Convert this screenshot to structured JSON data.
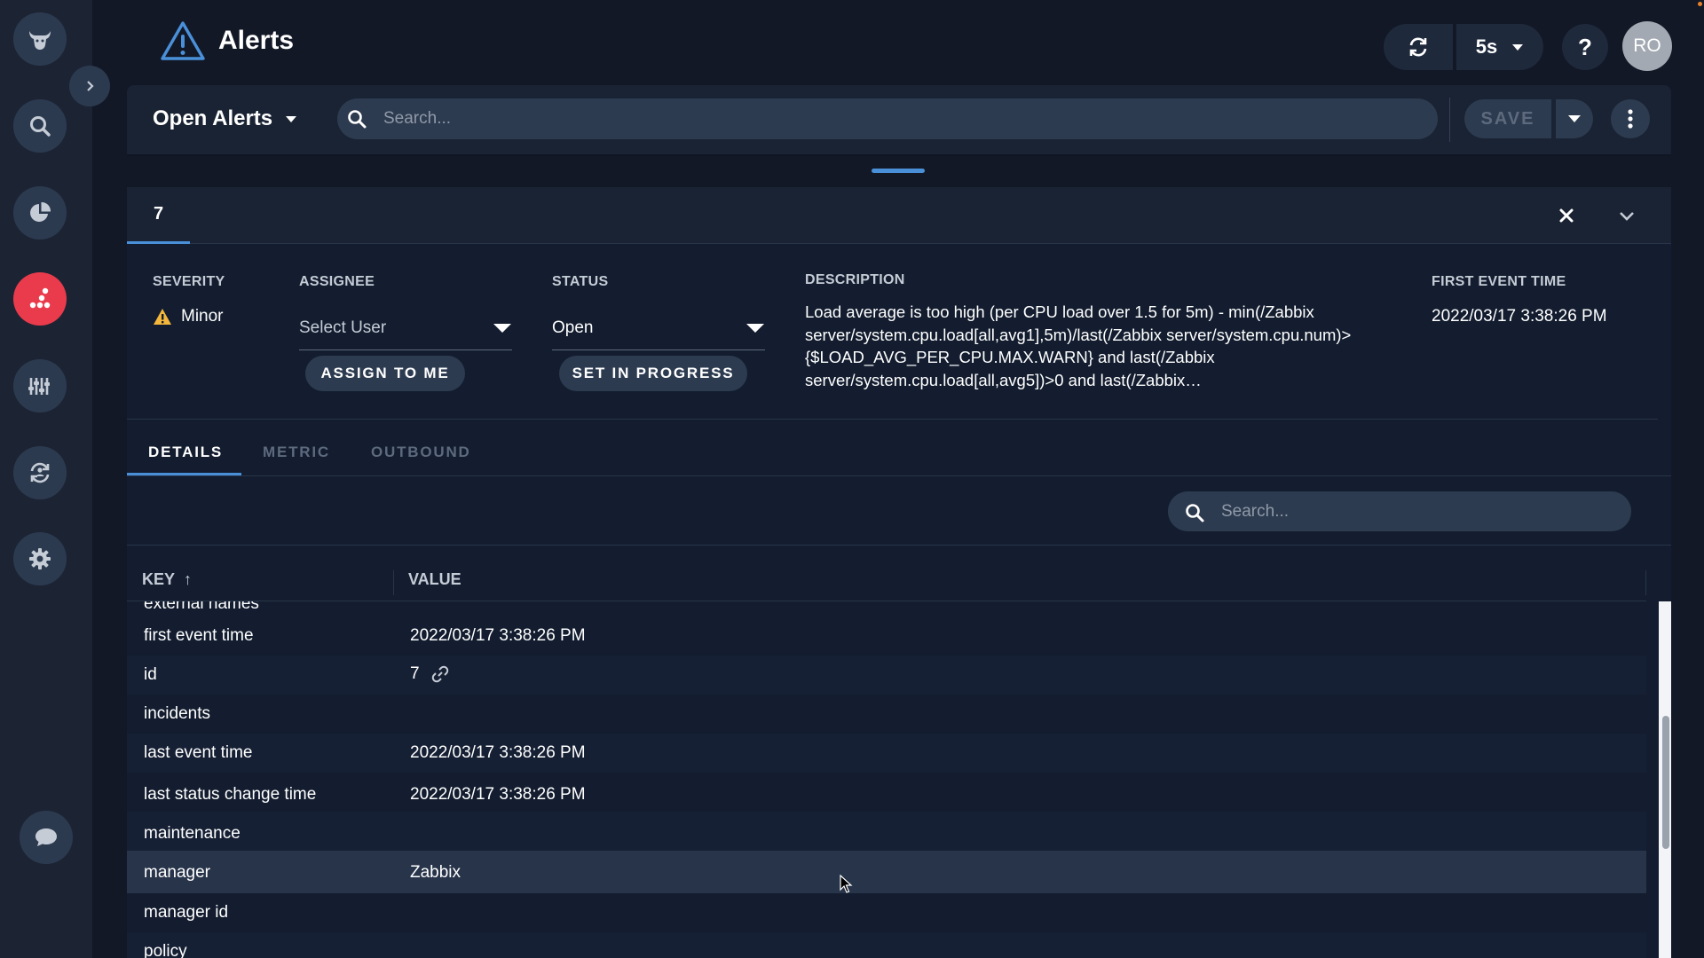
{
  "header": {
    "title": "Alerts",
    "refresh_interval": "5s",
    "help_label": "?",
    "user_initials": "RO"
  },
  "sidebar": {
    "items": [
      {
        "name": "logo",
        "icon": "bull-icon"
      },
      {
        "name": "search",
        "icon": "search-icon"
      },
      {
        "name": "dashboards",
        "icon": "pie-chart-icon"
      },
      {
        "name": "alerts",
        "icon": "alerts-dots-icon",
        "active": true
      },
      {
        "name": "tuning",
        "icon": "sliders-icon"
      },
      {
        "name": "integrations",
        "icon": "sync-icon"
      },
      {
        "name": "settings",
        "icon": "gear-icon"
      },
      {
        "name": "chat",
        "icon": "chat-bubble-icon"
      }
    ]
  },
  "filter_bar": {
    "view_name": "Open Alerts",
    "search_placeholder": "Search...",
    "save_label": "SAVE"
  },
  "alert": {
    "tab_label": "7",
    "severity_label": "SEVERITY",
    "severity_value": "Minor",
    "assignee_label": "ASSIGNEE",
    "assignee_placeholder": "Select User",
    "assign_to_me_label": "ASSIGN TO ME",
    "status_label": "STATUS",
    "status_value": "Open",
    "set_in_progress_label": "SET IN PROGRESS",
    "description_label": "DESCRIPTION",
    "description_text": "Load average is too high (per CPU load over 1.5 for 5m) - min(/Zabbix server/system.cpu.load[all,avg1],5m)/last(/Zabbix server/system.cpu.num)>{$LOAD_AVG_PER_CPU.MAX.WARN} and last(/Zabbix server/system.cpu.load[all,avg5])>0 and last(/Zabbix…",
    "first_event_time_label": "FIRST EVENT TIME",
    "first_event_time_value": "2022/03/17 3:38:26 PM"
  },
  "sub_tabs": [
    {
      "label": "DETAILS",
      "active": true
    },
    {
      "label": "METRIC",
      "active": false
    },
    {
      "label": "OUTBOUND",
      "active": false
    }
  ],
  "details": {
    "search_placeholder": "Search...",
    "columns": {
      "key": "KEY",
      "sort_indicator": "↑",
      "value": "VALUE"
    },
    "rows": [
      {
        "key": "external names",
        "value": ""
      },
      {
        "key": "first event time",
        "value": "2022/03/17 3:38:26 PM"
      },
      {
        "key": "id",
        "value": "7",
        "has_link": true
      },
      {
        "key": "incidents",
        "value": ""
      },
      {
        "key": "last event time",
        "value": "2022/03/17 3:38:26 PM"
      },
      {
        "key": "last status change time",
        "value": "2022/03/17 3:38:26 PM"
      },
      {
        "key": "maintenance",
        "value": ""
      },
      {
        "key": "manager",
        "value": "Zabbix",
        "hovered": true
      },
      {
        "key": "manager id",
        "value": ""
      },
      {
        "key": "policy",
        "value": ""
      }
    ]
  },
  "colors": {
    "accent": "#4a90d9",
    "active_nav": "#ea3b4c",
    "warning": "#f5b73b",
    "background": "#121826"
  }
}
